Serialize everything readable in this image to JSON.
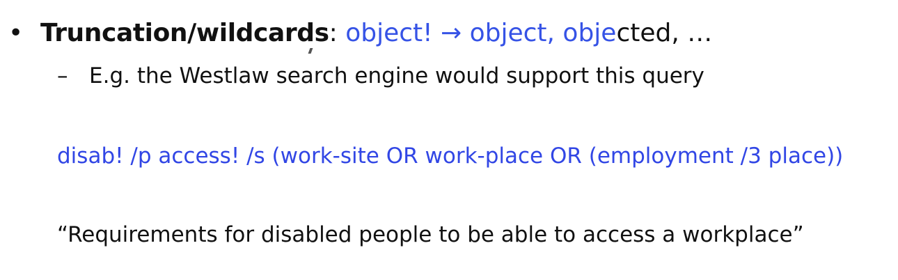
{
  "slide": {
    "bullet": {
      "dot": "•",
      "term": "Truncation/wildcards",
      "colon": ": ",
      "blue_prefix": "object! → object, obje",
      "black_suffix": "cted, …"
    },
    "sub_bullet": {
      "dash": "–",
      "text": "E.g. the Westlaw search engine would support this query"
    },
    "query": "disab! /p access! /s (work-site OR work-place OR (employment /3 place))",
    "quote": "“Requirements for disabled people to be able to access a workplace”"
  },
  "colors": {
    "background": "#ffffff",
    "text": "#111111",
    "blue_accent": "#3653e6",
    "query_blue": "#3146e5"
  },
  "icons": {
    "mouse_cursor": "mouse-pointer-icon"
  }
}
